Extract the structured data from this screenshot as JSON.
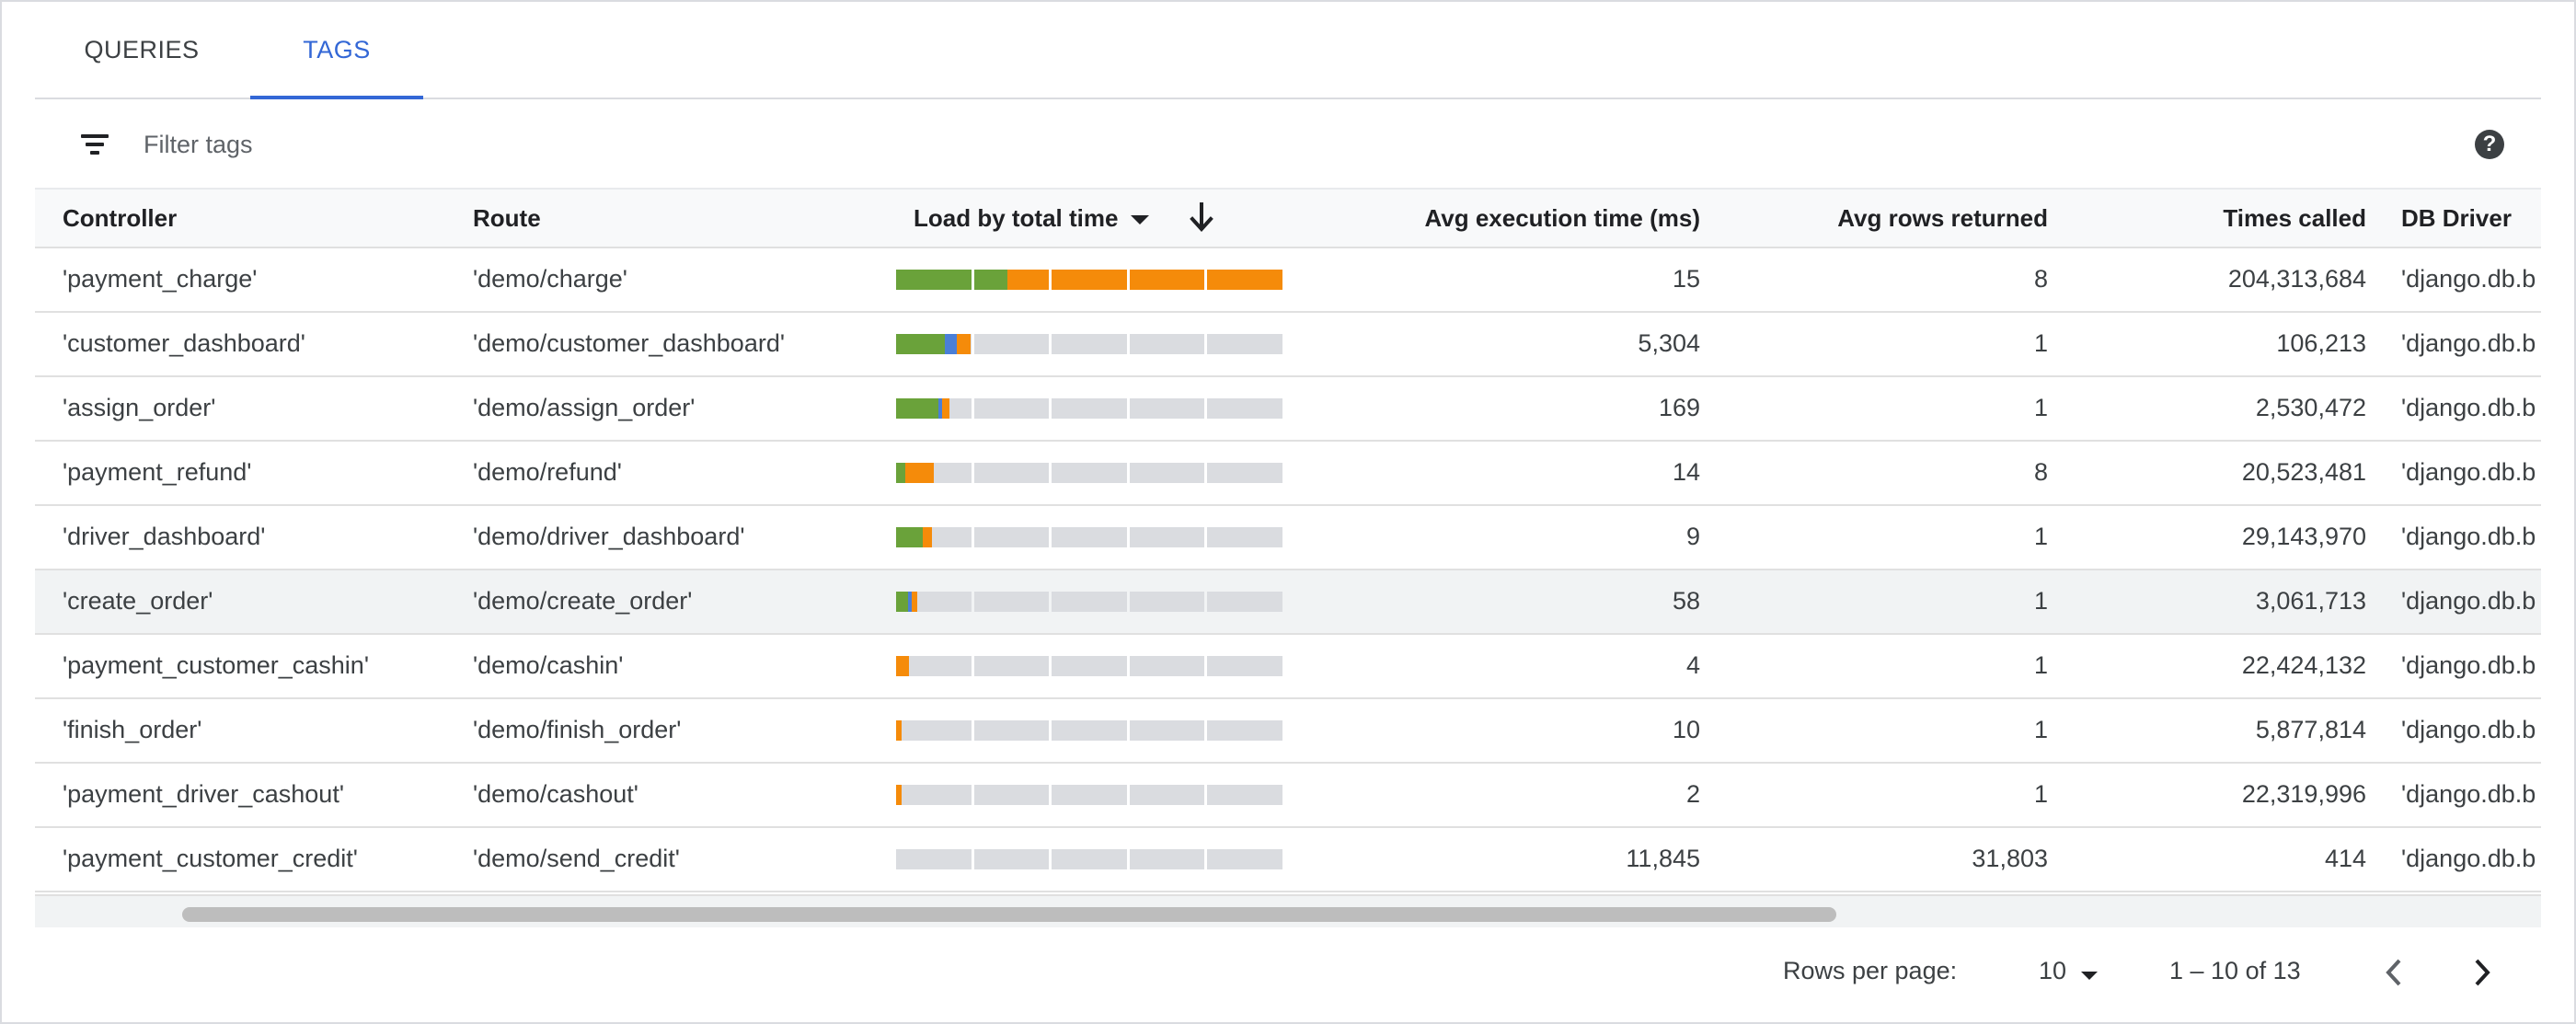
{
  "tabs": [
    {
      "label": "QUERIES",
      "active": false
    },
    {
      "label": "TAGS",
      "active": true
    }
  ],
  "filter": {
    "placeholder": "Filter tags",
    "value": ""
  },
  "columns": {
    "controller": "Controller",
    "route": "Route",
    "load": "Load by total time",
    "avg_exec": "Avg execution time (ms)",
    "avg_rows": "Avg rows returned",
    "times_called": "Times called",
    "db_driver": "DB Driver"
  },
  "colors": {
    "green": "#6aa23a",
    "blue": "#4a7fd8",
    "orange": "#f58b0a",
    "track": "#dadce0",
    "accent": "#3367d6"
  },
  "rows": [
    {
      "controller": "'payment_charge'",
      "route": "'demo/charge'",
      "avg_exec": "15",
      "avg_rows": "8",
      "times_called": "204,313,684",
      "db_driver": "'django.db.b",
      "load": [
        [
          "green",
          0.288
        ],
        [
          "orange",
          0.712
        ]
      ]
    },
    {
      "controller": "'customer_dashboard'",
      "route": "'demo/customer_dashboard'",
      "avg_exec": "5,304",
      "avg_rows": "1",
      "times_called": "106,213",
      "db_driver": "'django.db.b",
      "load": [
        [
          "green",
          0.127
        ],
        [
          "blue",
          0.031
        ],
        [
          "orange",
          0.035
        ]
      ]
    },
    {
      "controller": "'assign_order'",
      "route": "'demo/assign_order'",
      "avg_exec": "169",
      "avg_rows": "1",
      "times_called": "2,530,472",
      "db_driver": "'django.db.b",
      "load": [
        [
          "green",
          0.109
        ],
        [
          "blue",
          0.011
        ],
        [
          "orange",
          0.019
        ]
      ]
    },
    {
      "controller": "'payment_refund'",
      "route": "'demo/refund'",
      "avg_exec": "14",
      "avg_rows": "8",
      "times_called": "20,523,481",
      "db_driver": "'django.db.b",
      "load": [
        [
          "green",
          0.024
        ],
        [
          "orange",
          0.074
        ]
      ]
    },
    {
      "controller": "'driver_dashboard'",
      "route": "'demo/driver_dashboard'",
      "avg_exec": "9",
      "avg_rows": "1",
      "times_called": "29,143,970",
      "db_driver": "'django.db.b",
      "load": [
        [
          "green",
          0.069
        ],
        [
          "orange",
          0.023
        ]
      ]
    },
    {
      "controller": "'create_order'",
      "route": "'demo/create_order'",
      "avg_exec": "58",
      "avg_rows": "1",
      "times_called": "3,061,713",
      "db_driver": "'django.db.b",
      "load": [
        [
          "green",
          0.031
        ],
        [
          "blue",
          0.01
        ],
        [
          "orange",
          0.013
        ]
      ],
      "highlight": true
    },
    {
      "controller": "'payment_customer_cashin'",
      "route": "'demo/cashin'",
      "avg_exec": "4",
      "avg_rows": "1",
      "times_called": "22,424,132",
      "db_driver": "'django.db.b",
      "load": [
        [
          "orange",
          0.034
        ]
      ]
    },
    {
      "controller": "'finish_order'",
      "route": "'demo/finish_order'",
      "avg_exec": "10",
      "avg_rows": "1",
      "times_called": "5,877,814",
      "db_driver": "'django.db.b",
      "load": [
        [
          "orange",
          0.015
        ]
      ]
    },
    {
      "controller": "'payment_driver_cashout'",
      "route": "'demo/cashout'",
      "avg_exec": "2",
      "avg_rows": "1",
      "times_called": "22,319,996",
      "db_driver": "'django.db.b",
      "load": [
        [
          "orange",
          0.015
        ]
      ]
    },
    {
      "controller": "'payment_customer_credit'",
      "route": "'demo/send_credit'",
      "avg_exec": "11,845",
      "avg_rows": "31,803",
      "times_called": "414",
      "db_driver": "'django.db.b",
      "load": []
    }
  ],
  "pagination": {
    "rows_per_page_label": "Rows per page:",
    "rows_per_page_value": "10",
    "range": "1 – 10 of 13"
  }
}
